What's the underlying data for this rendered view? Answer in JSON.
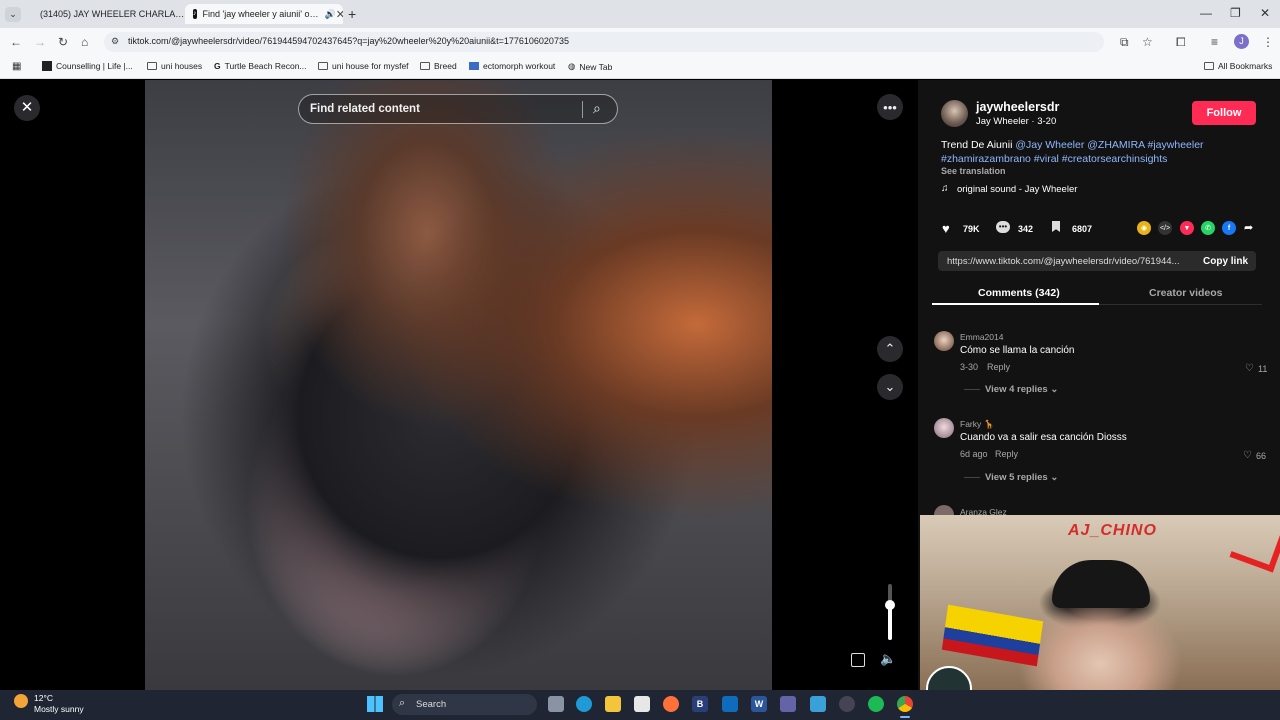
{
  "browser": {
    "tabs": [
      {
        "label": "(31405) JAY WHEELER CHARLA…",
        "active": false
      },
      {
        "label": "Find 'jay wheeler y aiunii' o…",
        "active": true
      }
    ],
    "url": "tiktok.com/@jaywheelersdr/video/7619445947024376​45?q=jay%20wheeler%20y%20aiunii&t=1776106020735",
    "bookmarks": [
      "Counselling | Life |...",
      "uni houses",
      "Turtle Beach Recon...",
      "uni house for mysfef",
      "Breed",
      "ectomorph workout",
      "New Tab"
    ],
    "all_bookmarks": "All Bookmarks",
    "profile_initial": "J"
  },
  "video": {
    "search_placeholder": "Find related content"
  },
  "post": {
    "username": "jaywheelersdr",
    "display_line": "Jay Wheeler · 3-20",
    "follow_label": "Follow",
    "caption_plain": "Trend De Aiunii ",
    "caption_tags_1": "@Jay Wheeler @ZHAMIRA #jaywheeler",
    "caption_tags_2": "#zhamirazambrano #viral #creatorsearchinsights",
    "see_translation": "See translation",
    "sound": "original sound - Jay Wheeler",
    "likes": "79K",
    "comments": "342",
    "saves": "6807",
    "share_link": "https://www.tiktok.com/@jaywheelersdr/video/761944...",
    "copy_link": "Copy link",
    "tab_comments": "Comments (342)",
    "tab_creator_videos": "Creator videos"
  },
  "comments": [
    {
      "user": "Emma2014",
      "text": "Cómo se llama la canción",
      "date": "3-30",
      "reply": "Reply",
      "likes": "11",
      "view_replies": "View 4 replies"
    },
    {
      "user": "Farky 🦒",
      "text": "Cuando va a salir esa canción Diosss",
      "date": "6d ago",
      "reply": "Reply",
      "likes": "66",
      "view_replies": "View 5 replies"
    },
    {
      "user": "Aranza Glez"
    }
  ],
  "stream_overlay": {
    "name_text": "AJ_CHINO"
  },
  "taskbar": {
    "temperature": "12°C",
    "weather": "Mostly sunny",
    "search_label": "Search"
  },
  "colors": {
    "follow": "#fe2c55",
    "tag_link": "#8fb7ff",
    "panel_bg": "#121212"
  }
}
